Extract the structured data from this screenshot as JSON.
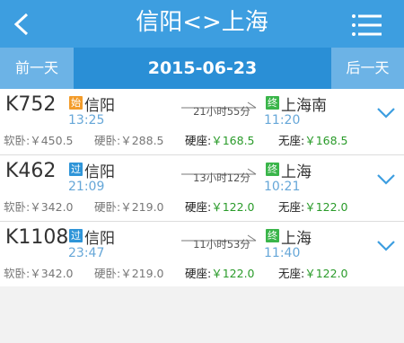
{
  "header": {
    "title": "信阳<>上海"
  },
  "datebar": {
    "prev_label": "前一天",
    "date": "2015-06-23",
    "next_label": "后一天"
  },
  "trains": [
    {
      "number": "K752",
      "from_tag": "始",
      "from_tag_type": "origin",
      "from": "信阳",
      "depart": "13:25",
      "duration": "21小时55分",
      "to_tag": "终",
      "to": "上海南",
      "arrive": "11:20",
      "soft_sleeper": "软卧:￥450.5",
      "hard_sleeper": "硬卧:￥288.5",
      "hard_seat_label": "硬座:",
      "hard_seat_price": "￥168.5",
      "no_seat_label": "无座:",
      "no_seat_price": "￥168.5"
    },
    {
      "number": "K462",
      "from_tag": "过",
      "from_tag_type": "pass",
      "from": "信阳",
      "depart": "21:09",
      "duration": "13小时12分",
      "to_tag": "终",
      "to": "上海",
      "arrive": "10:21",
      "soft_sleeper": "软卧:￥342.0",
      "hard_sleeper": "硬卧:￥219.0",
      "hard_seat_label": "硬座:",
      "hard_seat_price": "￥122.0",
      "no_seat_label": "无座:",
      "no_seat_price": "￥122.0"
    },
    {
      "number": "K1108",
      "from_tag": "过",
      "from_tag_type": "pass",
      "from": "信阳",
      "depart": "23:47",
      "duration": "11小时53分",
      "to_tag": "终",
      "to": "上海",
      "arrive": "11:40",
      "soft_sleeper": "软卧:￥342.0",
      "hard_sleeper": "硬卧:￥219.0",
      "hard_seat_label": "硬座:",
      "hard_seat_price": "￥122.0",
      "no_seat_label": "无座:",
      "no_seat_price": "￥122.0"
    }
  ],
  "icons": {
    "back": "back-arrow-icon",
    "menu": "menu-icon",
    "expand": "chevron-down-icon"
  },
  "colors": {
    "header": "#3d9ee0",
    "date_bar": "#2a8fd6",
    "nav_button": "#6cb3e6",
    "origin_tag": "#f39c2a",
    "pass_tag": "#2f95d8",
    "terminal_tag": "#3ab54a",
    "price_green": "#2a9b2a",
    "time_blue": "#66a7d8"
  }
}
